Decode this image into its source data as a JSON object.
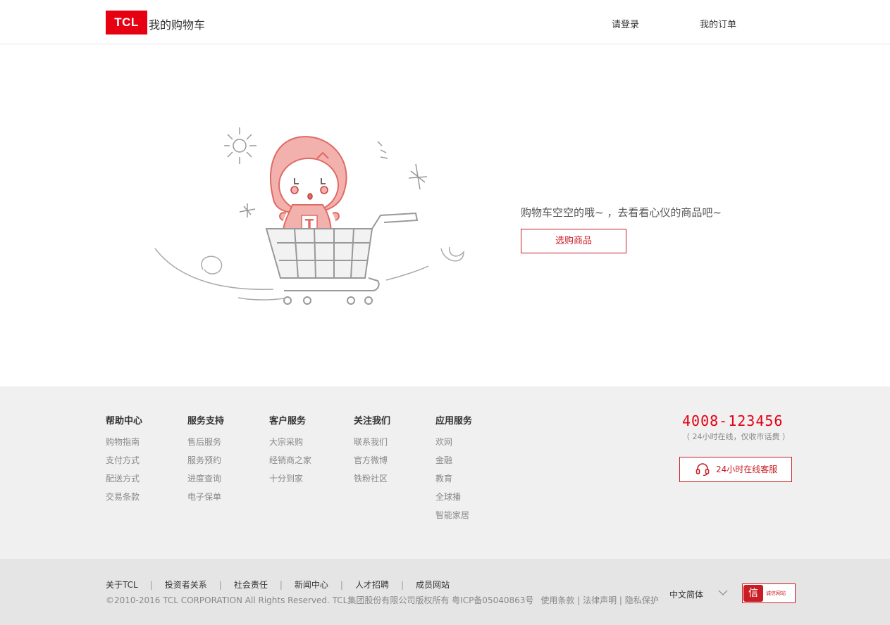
{
  "header": {
    "logo_text": "TCL",
    "title": "我的购物车",
    "login": "请登录",
    "orders": "我的订单"
  },
  "main": {
    "empty_message": "购物车空空的哦~ ，去看看心仪的商品吧~",
    "shop_button": "选购商品",
    "mascot_shirt_letter": "T"
  },
  "footer": {
    "columns": [
      {
        "title": "帮助中心",
        "links": [
          "购物指南",
          "支付方式",
          "配送方式",
          "交易条款"
        ]
      },
      {
        "title": "服务支持",
        "links": [
          "售后服务",
          "服务预约",
          "进度查询",
          "电子保单"
        ]
      },
      {
        "title": "客户服务",
        "links": [
          "大宗采购",
          "经销商之家",
          "十分到家"
        ]
      },
      {
        "title": "关注我们",
        "links": [
          "联系我们",
          "官方微博",
          "铁粉社区"
        ]
      },
      {
        "title": "应用服务",
        "links": [
          "欢网",
          "金融",
          "教育",
          "全球播",
          "智能家居"
        ]
      }
    ],
    "hotline": "4008-123456",
    "hotline_note": "（ 24小时在线，仅收市话费 ）",
    "service_button": "24小时在线客服"
  },
  "bottom": {
    "links": [
      "关于TCL",
      "投资者关系",
      "社会责任",
      "新闻中心",
      "人才招聘",
      "成员网站"
    ],
    "separator": "|",
    "copyright": "©2010-2016 TCL CORPORATION All Rights Reserved. TCL集团股份有限公司版权所有 粤ICP备05040863号",
    "legal": "使用条款 | 法律声明 | 隐私保护",
    "language": "中文简体",
    "badge_seal": "信",
    "badge_text": "诚信网站"
  },
  "colors": {
    "brand_red": "#e60012",
    "button_red": "#c81d25",
    "footer_bg": "#f0f0f0",
    "bottom_bg": "#e5e5e5"
  }
}
